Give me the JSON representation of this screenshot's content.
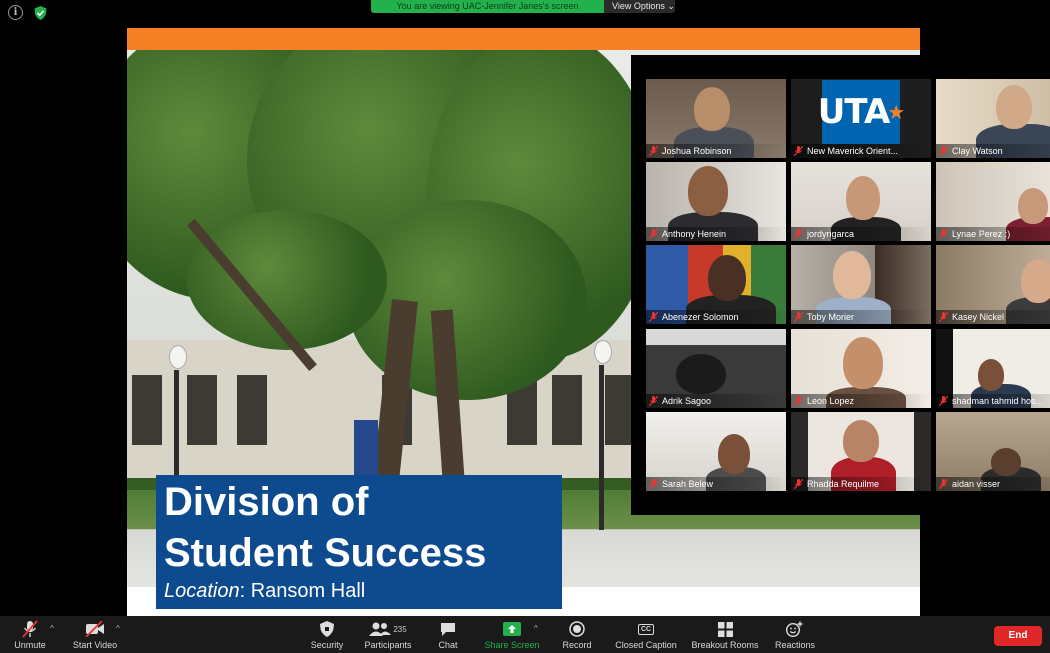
{
  "banner": {
    "text": "You are viewing UAC-Jennifer Janes's screen",
    "view_options": "View Options"
  },
  "slide": {
    "title_line1": "Division of",
    "title_line2": "Student Success",
    "location_label": "Location",
    "location_value": ": Ransom Hall",
    "accent_color": "#f58025",
    "title_bg": "#0d4a8e"
  },
  "gallery": {
    "participants": [
      {
        "name": "Joshua Robinson",
        "muted": true
      },
      {
        "name": "New Maverick Orient...",
        "muted": true,
        "logo": "UTA"
      },
      {
        "name": "Clay Watson",
        "muted": true
      },
      {
        "name": "Anthony Henein",
        "muted": true
      },
      {
        "name": "jordyngarca",
        "muted": true
      },
      {
        "name": "Lynae Perez :)",
        "muted": true
      },
      {
        "name": "Abenezer Solomon",
        "muted": true
      },
      {
        "name": "Toby Morier",
        "muted": true
      },
      {
        "name": "Kasey Nickel",
        "muted": true
      },
      {
        "name": "Adrik Sagoo",
        "muted": true
      },
      {
        "name": "Leon Lopez",
        "muted": true
      },
      {
        "name": "shadman tahmid hos...",
        "muted": true
      },
      {
        "name": "Sarah Belew",
        "muted": true
      },
      {
        "name": "Rhadda Requilme",
        "muted": true
      },
      {
        "name": "aidan visser",
        "muted": true
      }
    ]
  },
  "toolbar": {
    "unmute": "Unmute",
    "start_video": "Start Video",
    "security": "Security",
    "participants": "Participants",
    "participants_count": "235",
    "chat": "Chat",
    "share_screen": "Share Screen",
    "record": "Record",
    "closed_caption": "Closed Caption",
    "closed_caption_icon_text": "CC",
    "breakout_rooms": "Breakout Rooms",
    "reactions": "Reactions",
    "end": "End",
    "share_color": "#23b14d",
    "end_color": "#e02828"
  }
}
